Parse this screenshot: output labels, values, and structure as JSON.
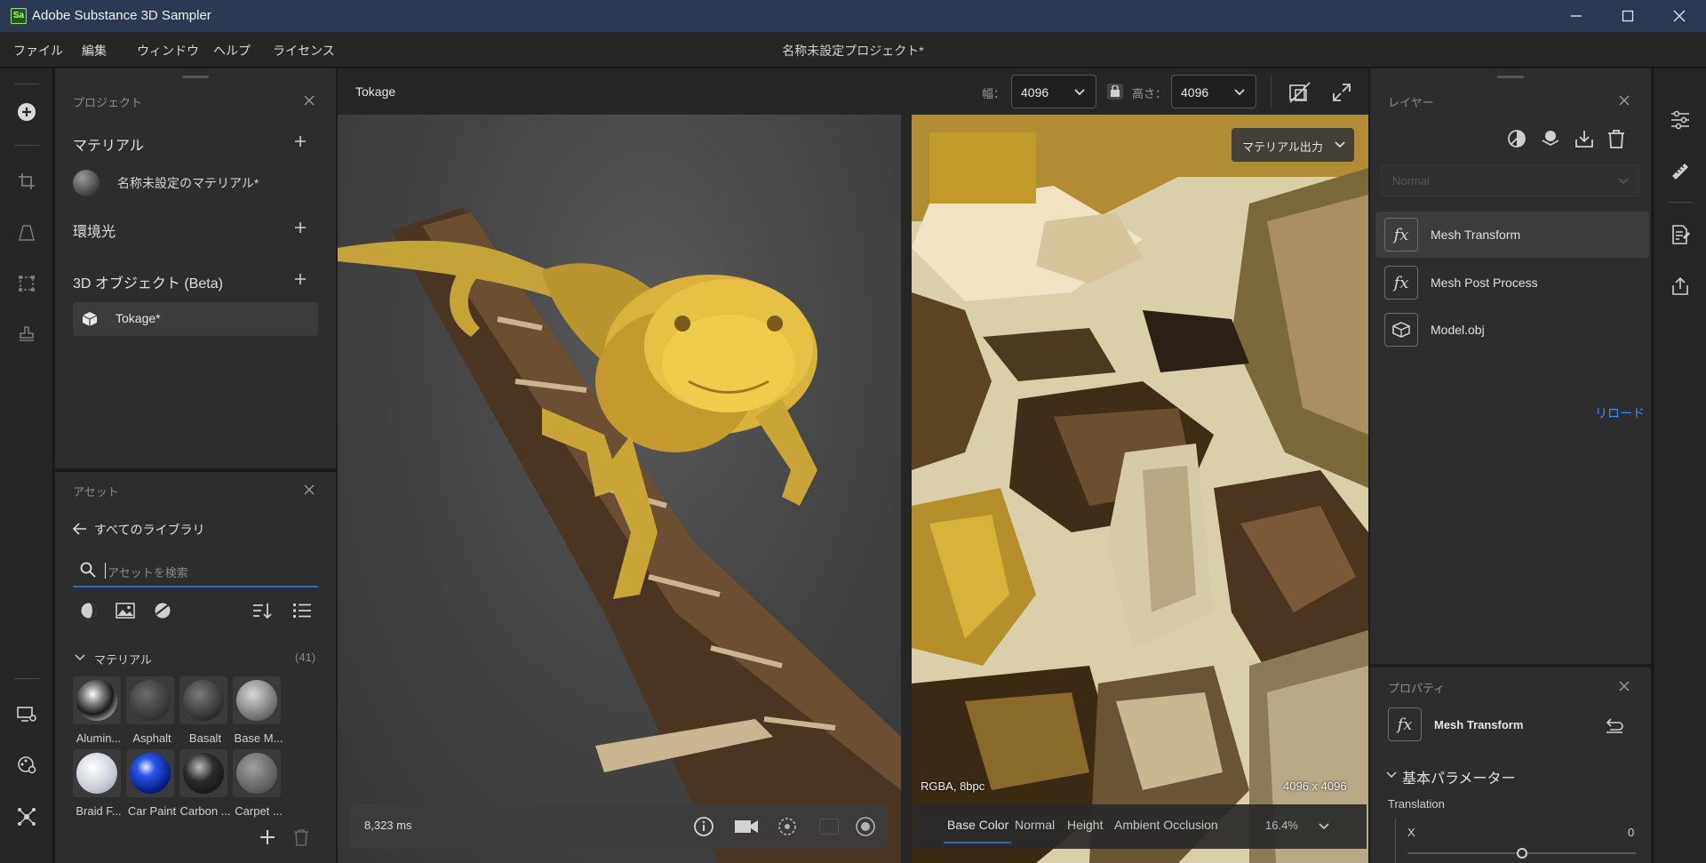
{
  "window": {
    "title": "Adobe Substance 3D Sampler",
    "logo_text": "Sa"
  },
  "menu": {
    "items": [
      "ファイル",
      "編集",
      "ウィンドウ",
      "ヘルプ",
      "ライセンス"
    ],
    "project_title": "名称未設定プロジェクト*"
  },
  "project_panel": {
    "title": "プロジェクト",
    "materials_label": "マテリアル",
    "material_item": "名称未設定のマテリアル*",
    "lights_label": "環境光",
    "objects_label": "3D オブジェクト (Beta)",
    "object_item": "Tokage*"
  },
  "assets_panel": {
    "title": "アセット",
    "back_label": "すべてのライブラリ",
    "search_placeholder": "アセットを検索",
    "group_label": "マテリアル",
    "group_count": "(41)",
    "materials": [
      {
        "label": "Alumin..."
      },
      {
        "label": "Asphalt"
      },
      {
        "label": "Basalt"
      },
      {
        "label": "Base M..."
      },
      {
        "label": "Braid F..."
      },
      {
        "label": "Car Paint"
      },
      {
        "label": "Carbon ..."
      },
      {
        "label": "Carpet ..."
      }
    ]
  },
  "viewport": {
    "title": "Tokage",
    "width_label": "幅：",
    "width_value": "4096",
    "height_label": "高さ：",
    "height_value": "4096",
    "render_time": "8,323 ms",
    "output_button": "マテリアル出力",
    "format_info": "RGBA, 8bpc",
    "resolution_info": "4096 x 4096",
    "zoom": "16.4%",
    "channels": [
      "Base Color",
      "Normal",
      "Height",
      "Ambient Occlusion"
    ],
    "active_channel": "Base Color"
  },
  "layers_panel": {
    "title": "レイヤー",
    "blend_mode": "Normal",
    "layers": [
      {
        "label": "Mesh Transform",
        "icon": "fx-icon",
        "selected": true
      },
      {
        "label": "Mesh Post Process",
        "icon": "fx-icon",
        "selected": false
      },
      {
        "label": "Model.obj",
        "icon": "mesh-icon",
        "selected": false
      }
    ],
    "reload_link": "リロード"
  },
  "properties_panel": {
    "title": "プロパティ",
    "filter_name": "Mesh Transform",
    "section": "基本パラメーター",
    "translation_label": "Translation",
    "x_label": "X",
    "x_value": "0"
  },
  "colors": {
    "titlebar": "#2b3a52",
    "accent": "#2f67c7",
    "link": "#3d8ef2"
  }
}
